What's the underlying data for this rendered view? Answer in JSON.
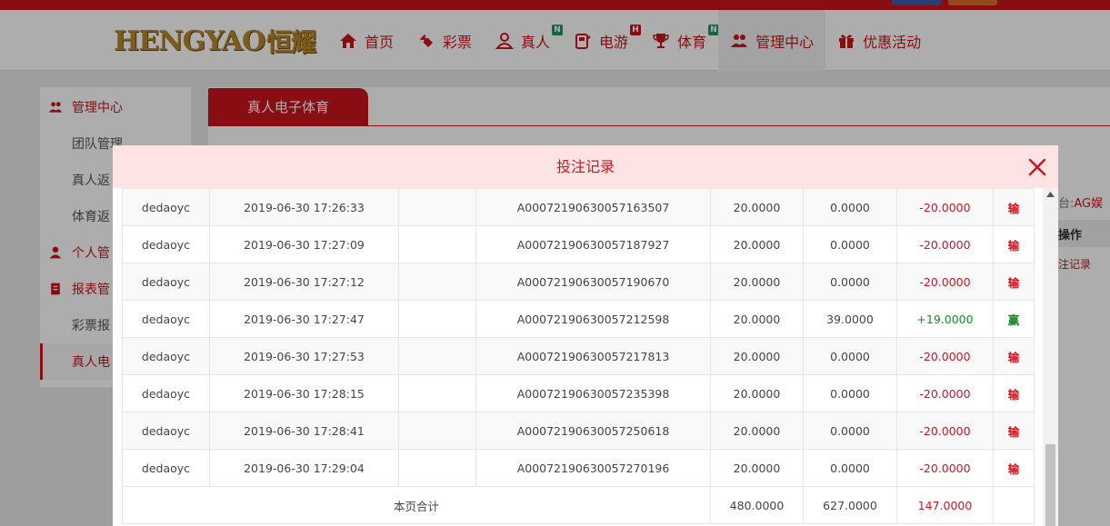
{
  "header": {
    "logo_latin": "HENGYAO",
    "logo_cn": "恒耀",
    "nav": [
      {
        "label": "首页",
        "icon": "home-icon",
        "badge": ""
      },
      {
        "label": "彩票",
        "icon": "ticket-icon",
        "badge": ""
      },
      {
        "label": "真人",
        "icon": "dealer-icon",
        "badge": "N"
      },
      {
        "label": "电游",
        "icon": "arcade-icon",
        "badge": "H"
      },
      {
        "label": "体育",
        "icon": "trophy-icon",
        "badge": "N"
      },
      {
        "label": "管理中心",
        "icon": "users-icon",
        "badge": ""
      },
      {
        "label": "优惠活动",
        "icon": "gift-icon",
        "badge": ""
      }
    ]
  },
  "sidebar": {
    "items": [
      {
        "label": "管理中心",
        "icon": "users-icon"
      },
      {
        "label": "团队管理"
      },
      {
        "label": "真人返"
      },
      {
        "label": "体育返"
      },
      {
        "label": "个人管",
        "icon": "user-icon"
      },
      {
        "label": "报表管",
        "icon": "report-icon"
      },
      {
        "label": "彩票报"
      },
      {
        "label": "真人电"
      }
    ]
  },
  "main": {
    "tab_label": "真人电子体育",
    "platform_prefix": "台:",
    "platform_value": "AG娱",
    "column_action": "操作",
    "action_link": "注记录"
  },
  "modal": {
    "title": "投注记录",
    "rows": [
      {
        "user": "dedaoyc",
        "time": "2019-06-30 17:26:33",
        "blank": "",
        "order": "A00072190630057163507",
        "bet": "20.0000",
        "payout": "0.0000",
        "result": "-20.0000",
        "status": "输"
      },
      {
        "user": "dedaoyc",
        "time": "2019-06-30 17:27:09",
        "blank": "",
        "order": "A00072190630057187927",
        "bet": "20.0000",
        "payout": "0.0000",
        "result": "-20.0000",
        "status": "输"
      },
      {
        "user": "dedaoyc",
        "time": "2019-06-30 17:27:12",
        "blank": "",
        "order": "A00072190630057190670",
        "bet": "20.0000",
        "payout": "0.0000",
        "result": "-20.0000",
        "status": "输"
      },
      {
        "user": "dedaoyc",
        "time": "2019-06-30 17:27:47",
        "blank": "",
        "order": "A00072190630057212598",
        "bet": "20.0000",
        "payout": "39.0000",
        "result": "+19.0000",
        "status": "赢"
      },
      {
        "user": "dedaoyc",
        "time": "2019-06-30 17:27:53",
        "blank": "",
        "order": "A00072190630057217813",
        "bet": "20.0000",
        "payout": "0.0000",
        "result": "-20.0000",
        "status": "输"
      },
      {
        "user": "dedaoyc",
        "time": "2019-06-30 17:28:15",
        "blank": "",
        "order": "A00072190630057235398",
        "bet": "20.0000",
        "payout": "0.0000",
        "result": "-20.0000",
        "status": "输"
      },
      {
        "user": "dedaoyc",
        "time": "2019-06-30 17:28:41",
        "blank": "",
        "order": "A00072190630057250618",
        "bet": "20.0000",
        "payout": "0.0000",
        "result": "-20.0000",
        "status": "输"
      },
      {
        "user": "dedaoyc",
        "time": "2019-06-30 17:29:04",
        "blank": "",
        "order": "A00072190630057270196",
        "bet": "20.0000",
        "payout": "0.0000",
        "result": "-20.0000",
        "status": "输"
      }
    ],
    "total": {
      "label": "本页合计",
      "bet": "480.0000",
      "payout": "627.0000",
      "result": "147.0000"
    }
  },
  "colors": {
    "brand_red": "#c9161d",
    "win_green": "#1a8a2e",
    "modal_head": "#fde3e3"
  }
}
